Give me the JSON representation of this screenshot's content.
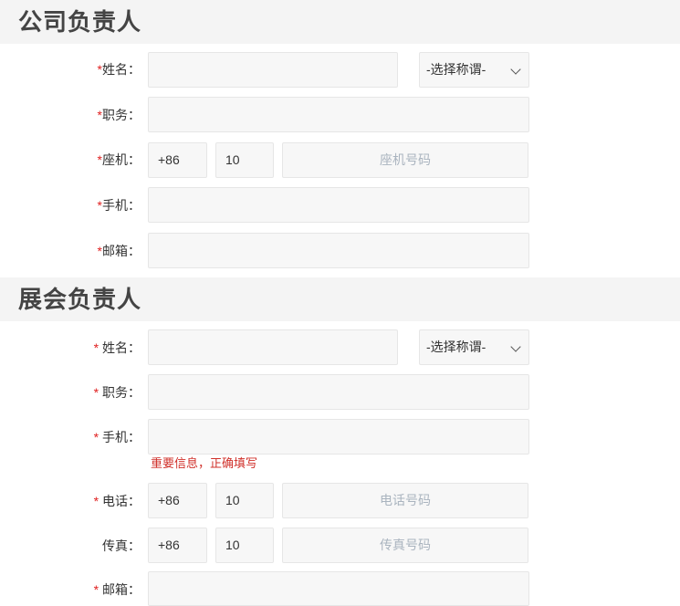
{
  "company": {
    "title": "公司负责人",
    "name_label": "姓名：",
    "title_select": "-选择称谓-",
    "position_label": "职务：",
    "landline_label": "座机：",
    "landline_country": "+86",
    "landline_area": "10",
    "landline_placeholder": "座机号码",
    "mobile_label": "手机：",
    "email_label": "邮箱："
  },
  "exhibition": {
    "title": "展会负责人",
    "name_label": " 姓名：",
    "title_select": "-选择称谓-",
    "position_label": " 职务：",
    "mobile_label": " 手机：",
    "mobile_hint": "重要信息，正确填写",
    "phone_label": " 电话：",
    "phone_country": "+86",
    "phone_area": "10",
    "phone_placeholder": "电话号码",
    "fax_label": "传真：",
    "fax_country": "+86",
    "fax_area": "10",
    "fax_placeholder": "传真号码",
    "email_label": " 邮箱："
  },
  "required_mark": "*"
}
